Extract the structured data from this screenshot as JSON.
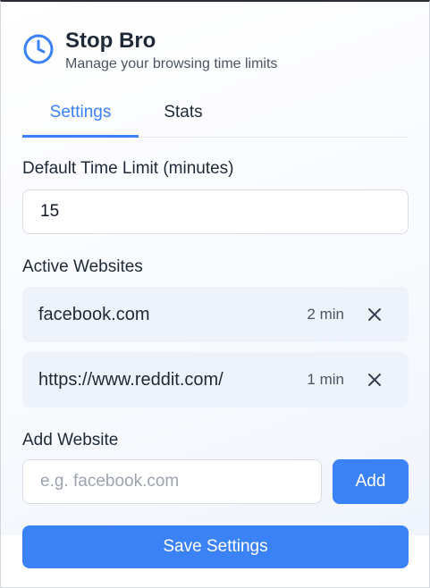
{
  "header": {
    "title": "Stop Bro",
    "subtitle": "Manage your browsing time limits",
    "icon": "clock-icon"
  },
  "tabs": [
    {
      "label": "Settings",
      "active": true
    },
    {
      "label": "Stats",
      "active": false
    }
  ],
  "default_limit": {
    "label": "Default Time Limit (minutes)",
    "value": "15"
  },
  "active_websites": {
    "label": "Active Websites",
    "items": [
      {
        "url": "facebook.com",
        "time": "2 min"
      },
      {
        "url": "https://www.reddit.com/",
        "time": "1 min"
      }
    ]
  },
  "add_website": {
    "label": "Add Website",
    "placeholder": "e.g. facebook.com",
    "button_label": "Add"
  },
  "save_button_label": "Save Settings",
  "colors": {
    "accent": "#3b82f6",
    "row_background": "#eef3fb"
  }
}
